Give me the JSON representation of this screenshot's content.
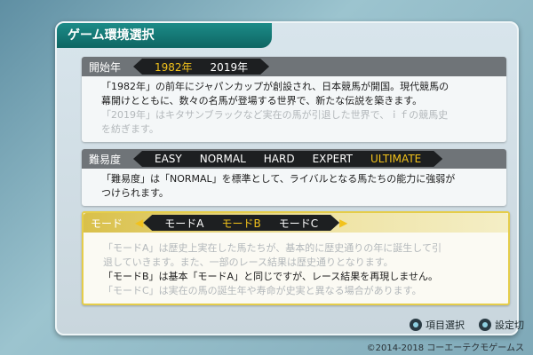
{
  "panel": {
    "title": "ゲーム環境選択"
  },
  "start_year": {
    "label": "開始年",
    "options": [
      "1982年",
      "2019年"
    ],
    "selected": "1982年",
    "desc": [
      "「1982年」の前年にジャパンカップが創設され、日本競馬が開国。現代競馬の",
      "幕開けとともに、数々の名馬が登場する世界で、新たな伝説を築きます。"
    ],
    "desc_faint": [
      "「2019年」はキタサンブラックなど実在の馬が引退した世界で、ｉｆの競馬史",
      "を紡ぎます。"
    ]
  },
  "difficulty": {
    "label": "難易度",
    "options": [
      "EASY",
      "NORMAL",
      "HARD",
      "EXPERT",
      "ULTIMATE"
    ],
    "selected": "ULTIMATE",
    "desc": [
      "「難易度」は「NORMAL」を標準として、ライバルとなる馬たちの能力に強弱が",
      "つけられます。"
    ]
  },
  "mode": {
    "label": "モード",
    "options": [
      "モードA",
      "モードB",
      "モードC"
    ],
    "selected": "モードB",
    "desc_faint_top": [
      "「モードA」は歴史上実在した馬たちが、基本的に歴史通りの年に誕生して引",
      "退していきます。また、一部のレース結果は歴史通りとなります。"
    ],
    "desc": [
      "「モードB」は基本「モードA」と同じですが、レース結果を再現しません。"
    ],
    "desc_faint_bottom": [
      "「モードC」は実在の馬の誕生年や寿命が史実と異なる場合があります。"
    ]
  },
  "footer": {
    "hint1": "項目選択",
    "hint2": "設定切",
    "copyright": "©2014-2018 コーエーテクモゲームス"
  },
  "colors": {
    "accent_teal": "#1c8b88",
    "selected_gold": "#f2c21b"
  }
}
